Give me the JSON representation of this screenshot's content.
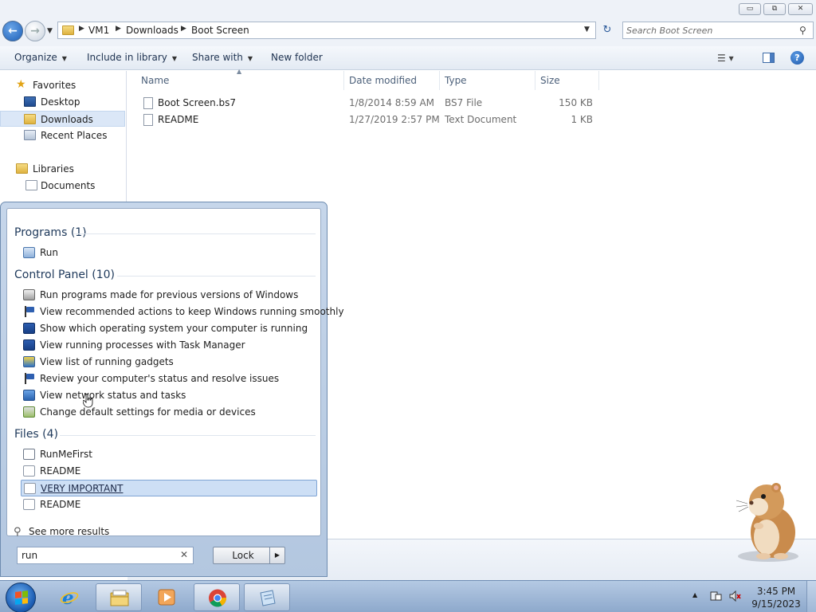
{
  "window": {
    "caption_buttons": {
      "minimize": "▭",
      "maximize": "⧉",
      "close": "✕"
    }
  },
  "address": {
    "breadcrumbs": [
      "VM1",
      "Downloads",
      "Boot Screen"
    ],
    "search_placeholder": "Search Boot Screen"
  },
  "toolbar": {
    "organize": "Organize",
    "include_in_library": "Include in library",
    "share_with": "Share with",
    "new_folder": "New folder"
  },
  "navpane": {
    "favorites": "Favorites",
    "items": [
      "Desktop",
      "Downloads",
      "Recent Places"
    ],
    "libraries": "Libraries",
    "library_items": [
      "Documents"
    ]
  },
  "filelist": {
    "columns": [
      "Name",
      "Date modified",
      "Type",
      "Size"
    ],
    "rows": [
      {
        "name": "Boot Screen.bs7",
        "date": "1/8/2014 8:59 AM",
        "type": "BS7 File",
        "size": "150 KB"
      },
      {
        "name": "README",
        "date": "1/27/2019 2:57 PM",
        "type": "Text Document",
        "size": "1 KB"
      }
    ]
  },
  "startmenu": {
    "sections": [
      {
        "title": "Programs (1)",
        "items": [
          {
            "label": "Run",
            "icon": "run-icon"
          }
        ]
      },
      {
        "title": "Control Panel (10)",
        "items": [
          {
            "label": "Run programs made for previous versions of Windows",
            "icon": "compatibility-icon"
          },
          {
            "label": "View recommended actions to keep Windows running smoothly",
            "icon": "action-center-flag-icon"
          },
          {
            "label": "Show which operating system your computer is running",
            "icon": "system-check-icon"
          },
          {
            "label": "View running processes with Task Manager",
            "icon": "system-check-icon"
          },
          {
            "label": "View list of running gadgets",
            "icon": "gadget-icon"
          },
          {
            "label": "Review your computer's status and resolve issues",
            "icon": "action-center-flag-icon"
          },
          {
            "label": "View network status and tasks",
            "icon": "network-icon"
          },
          {
            "label": "Change default settings for media or devices",
            "icon": "autoplay-icon"
          }
        ]
      },
      {
        "title": "Files (4)",
        "items": [
          {
            "label": "RunMeFirst",
            "icon": "shortcut-icon"
          },
          {
            "label": "README",
            "icon": "text-file-icon"
          },
          {
            "label": "VERY IMPORTANT",
            "icon": "text-file-icon"
          },
          {
            "label": "README",
            "icon": "text-file-icon"
          }
        ]
      }
    ],
    "highlighted": "VERY IMPORTANT",
    "see_more": "See more results",
    "search_value": "run",
    "lock_label": "Lock"
  },
  "taskbar": {
    "pinned": [
      "start-orb",
      "internet-explorer-icon",
      "windows-explorer-icon",
      "media-player-icon",
      "chrome-icon",
      "notepad-icon"
    ],
    "clock_time": "3:45 PM",
    "clock_date": "9/15/2023"
  },
  "colors": {
    "selection": "#cddff5",
    "taskbar": "#9fb8d8",
    "section_header": "#1e395b"
  }
}
